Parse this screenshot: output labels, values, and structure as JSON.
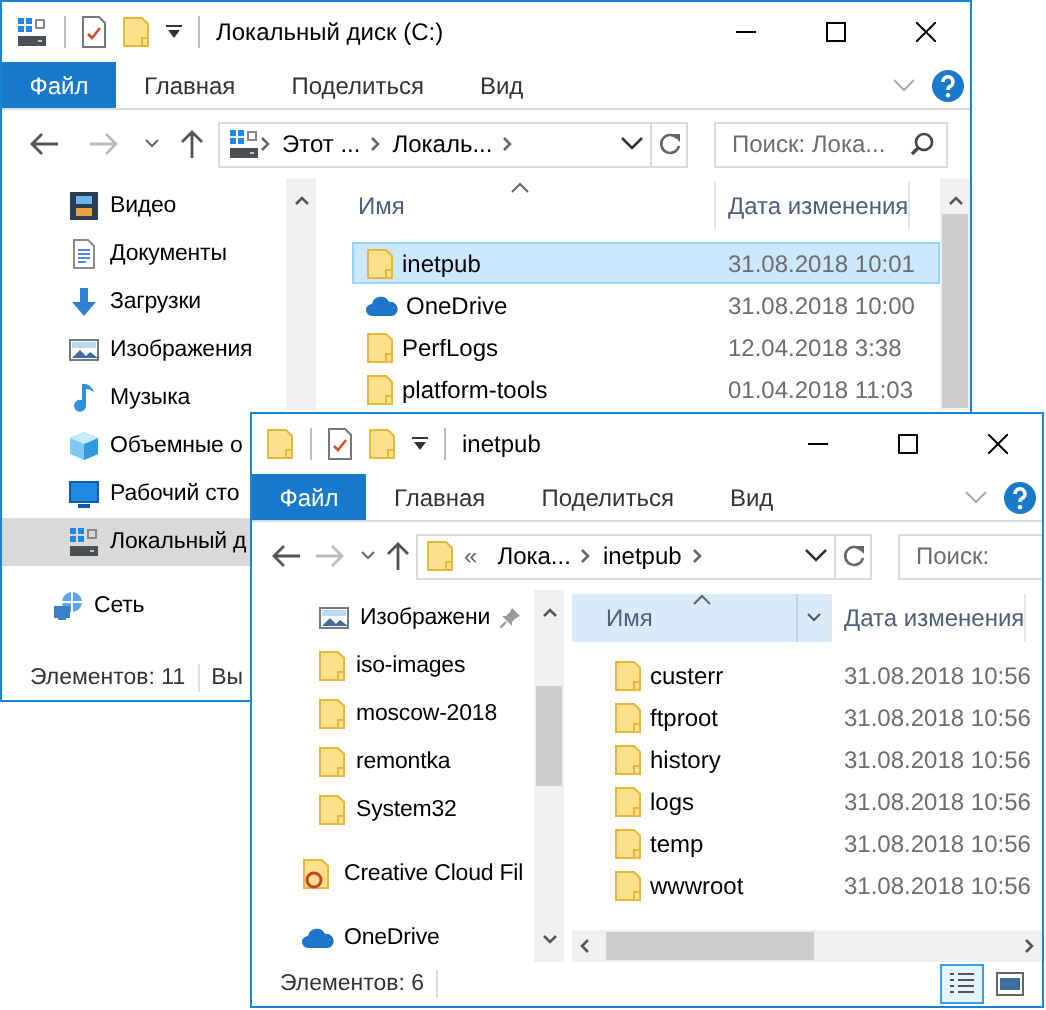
{
  "windows": [
    {
      "title": "Локальный диск (C:)",
      "ribbon_tabs": [
        {
          "label": "Файл",
          "kind": "file"
        },
        {
          "label": "Главная",
          "kind": "tab"
        },
        {
          "label": "Поделиться",
          "kind": "tab"
        },
        {
          "label": "Вид",
          "kind": "tab"
        }
      ],
      "address": {
        "crumbs": [
          "Этот ...",
          "Локаль..."
        ]
      },
      "search": {
        "placeholder": "Поиск: Лока..."
      },
      "nav_items": [
        {
          "label": "Видео",
          "kind": "video",
          "selected": false
        },
        {
          "label": "Документы",
          "kind": "documents",
          "selected": false
        },
        {
          "label": "Загрузки",
          "kind": "downloads",
          "selected": false
        },
        {
          "label": "Изображения",
          "kind": "pictures",
          "selected": false
        },
        {
          "label": "Музыка",
          "kind": "music",
          "selected": false
        },
        {
          "label": "Объемные о",
          "kind": "objects3d",
          "selected": false
        },
        {
          "label": "Рабочий сто",
          "kind": "desktop",
          "selected": false
        },
        {
          "label": "Локальный д",
          "kind": "drive",
          "selected": true
        },
        {
          "label": "Сеть",
          "kind": "network",
          "selected": false
        }
      ],
      "columns": [
        {
          "label": "Имя",
          "hovered": false
        },
        {
          "label": "Дата изменения",
          "hovered": false
        }
      ],
      "files": [
        {
          "name": "inetpub",
          "date": "31.08.2018 10:01",
          "kind": "folder",
          "selected": true
        },
        {
          "name": "OneDrive",
          "date": "31.08.2018 10:00",
          "kind": "onedrive",
          "selected": false
        },
        {
          "name": "PerfLogs",
          "date": "12.04.2018 3:38",
          "kind": "folder",
          "selected": false
        },
        {
          "name": "platform-tools",
          "date": "01.04.2018 11:03",
          "kind": "folder",
          "selected": false
        }
      ],
      "status": {
        "count": "Элементов: 11",
        "selection": "Вы"
      }
    },
    {
      "title": "inetpub",
      "ribbon_tabs": [
        {
          "label": "Файл",
          "kind": "file"
        },
        {
          "label": "Главная",
          "kind": "tab"
        },
        {
          "label": "Поделиться",
          "kind": "tab"
        },
        {
          "label": "Вид",
          "kind": "tab"
        }
      ],
      "address": {
        "overflow": "«",
        "crumbs": [
          "Лока...",
          "inetpub"
        ]
      },
      "search": {
        "placeholder": "Поиск:"
      },
      "nav_items": [
        {
          "label": "Изображени",
          "kind": "pictures",
          "selected": false,
          "pinned": true
        },
        {
          "label": "iso-images",
          "kind": "folder",
          "selected": false,
          "pinned": false
        },
        {
          "label": "moscow-2018",
          "kind": "folder",
          "selected": false,
          "pinned": false
        },
        {
          "label": "remontka",
          "kind": "folder",
          "selected": false,
          "pinned": false
        },
        {
          "label": "System32",
          "kind": "folder",
          "selected": false,
          "pinned": false
        },
        {
          "label": "Creative Cloud Fil",
          "kind": "creative_cloud",
          "selected": false,
          "pinned": false
        },
        {
          "label": "OneDrive",
          "kind": "onedrive",
          "selected": false,
          "pinned": false
        }
      ],
      "columns": [
        {
          "label": "Имя",
          "hovered": true
        },
        {
          "label": "Дата изменения",
          "hovered": false
        }
      ],
      "files": [
        {
          "name": "custerr",
          "date": "31.08.2018 10:56",
          "kind": "folder",
          "selected": false
        },
        {
          "name": "ftproot",
          "date": "31.08.2018 10:56",
          "kind": "folder",
          "selected": false
        },
        {
          "name": "history",
          "date": "31.08.2018 10:56",
          "kind": "folder",
          "selected": false
        },
        {
          "name": "logs",
          "date": "31.08.2018 10:56",
          "kind": "folder",
          "selected": false
        },
        {
          "name": "temp",
          "date": "31.08.2018 10:56",
          "kind": "folder",
          "selected": false
        },
        {
          "name": "wwwroot",
          "date": "31.08.2018 10:56",
          "kind": "folder",
          "selected": false
        }
      ],
      "status": {
        "count": "Элементов: 6",
        "view_modes": [
          {
            "kind": "details",
            "selected": true
          },
          {
            "kind": "tiles",
            "selected": false
          }
        ]
      }
    }
  ]
}
